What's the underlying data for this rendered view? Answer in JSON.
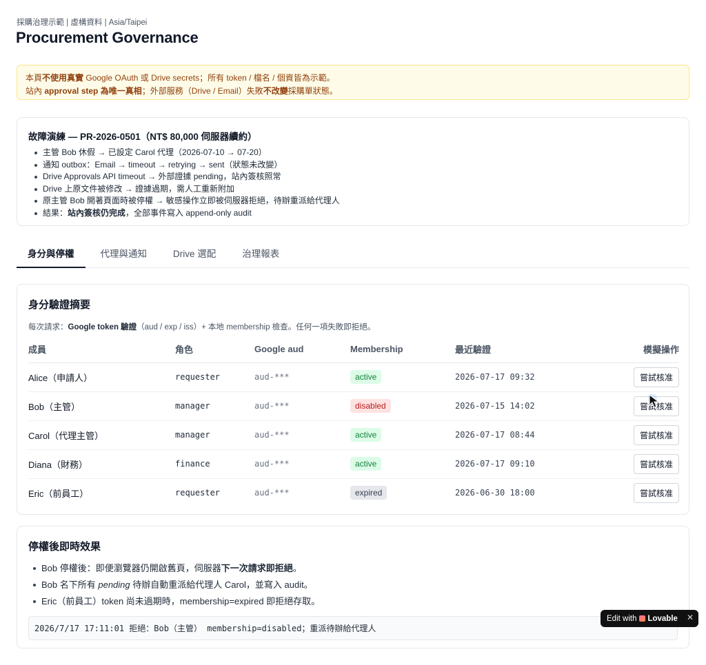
{
  "header": {
    "breadcrumb": "採購治理示範 | 虛構資料 | Asia/Taipei",
    "title": "Procurement Governance"
  },
  "notice": {
    "l1_a": "本頁",
    "l1_b": "不使用真實",
    "l1_c": " Google OAuth 或 Drive secrets；所有 token / 檔名 / 個資皆為示範。",
    "l2_a": "站內 ",
    "l2_b": "approval step 為唯一真相",
    "l2_c": "；外部服務（Drive / Email）失敗",
    "l2_d": "不改變",
    "l2_e": "採購單狀態。"
  },
  "drill": {
    "title": "故障演練 — PR-2026-0501（NT$ 80,000 伺服器續約）",
    "items": [
      "主管 Bob 休假 → 已設定 Carol 代理（2026-07-10 → 07-20）",
      "通知 outbox：Email → timeout → retrying → sent（狀態未改變）",
      "Drive Approvals API timeout → 外部證據 pending，站內簽核照常",
      "Drive 上原文件被修改 → 證據過期，需人工重新附加",
      "原主管 Bob 開著頁面時被停權 → 敏感操作立即被伺服器拒絕，待辦重派給代理人"
    ],
    "result_prefix": "結果：",
    "result_bold": "站內簽核仍完成",
    "result_suffix": "，全部事件寫入 append-only audit"
  },
  "tabs": [
    "身分與停權",
    "代理與通知",
    "Drive 選配",
    "治理報表"
  ],
  "auth": {
    "title": "身分驗證摘要",
    "desc_prefix": "每次請求：",
    "desc_bold": "Google token 驗證",
    "desc_suffix": "（aud / exp / iss）+ 本地 membership 檢查。任何一項失敗即拒絕。",
    "columns": [
      "成員",
      "角色",
      "Google aud",
      "Membership",
      "最近驗證",
      "模擬操作"
    ],
    "action_label": "嘗試核准",
    "rows": [
      {
        "name": "Alice（申請人）",
        "role": "requester",
        "aud": "aud-***",
        "membership": "active",
        "status": "active",
        "last": "2026-07-17 09:32"
      },
      {
        "name": "Bob（主管）",
        "role": "manager",
        "aud": "aud-***",
        "membership": "disabled",
        "status": "disabled",
        "last": "2026-07-15 14:02"
      },
      {
        "name": "Carol（代理主管）",
        "role": "manager",
        "aud": "aud-***",
        "membership": "active",
        "status": "active",
        "last": "2026-07-17 08:44"
      },
      {
        "name": "Diana（財務）",
        "role": "finance",
        "aud": "aud-***",
        "membership": "active",
        "status": "active",
        "last": "2026-07-17 09:10"
      },
      {
        "name": "Eric（前員工）",
        "role": "requester",
        "aud": "aud-***",
        "membership": "expired",
        "status": "expired",
        "last": "2026-06-30 18:00"
      }
    ]
  },
  "effect": {
    "title": "停權後即時效果",
    "item1_a": "Bob 停權後：即便瀏覽器仍開啟舊頁，伺服器",
    "item1_b": "下一次請求即拒絕",
    "item1_c": "。",
    "item2_a": "Bob 名下所有 ",
    "item2_b": "pending",
    "item2_c": " 待辦自動重派給代理人 Carol，並寫入 audit。",
    "item3": "Eric（前員工）token 尚未過期時，membership=expired 即拒絕存取。",
    "log": "2026/7/17 17:11:01 拒絕：Bob（主管） membership=disabled；重派待辦給代理人"
  },
  "badge": {
    "label": "Edit with",
    "brand": "Lovable",
    "close": "✕"
  },
  "colors": {
    "active_bg": "#dcfce7",
    "disabled_bg": "#fee2e2",
    "expired_bg": "#e5e7eb",
    "notice_bg": "#fefce8"
  }
}
